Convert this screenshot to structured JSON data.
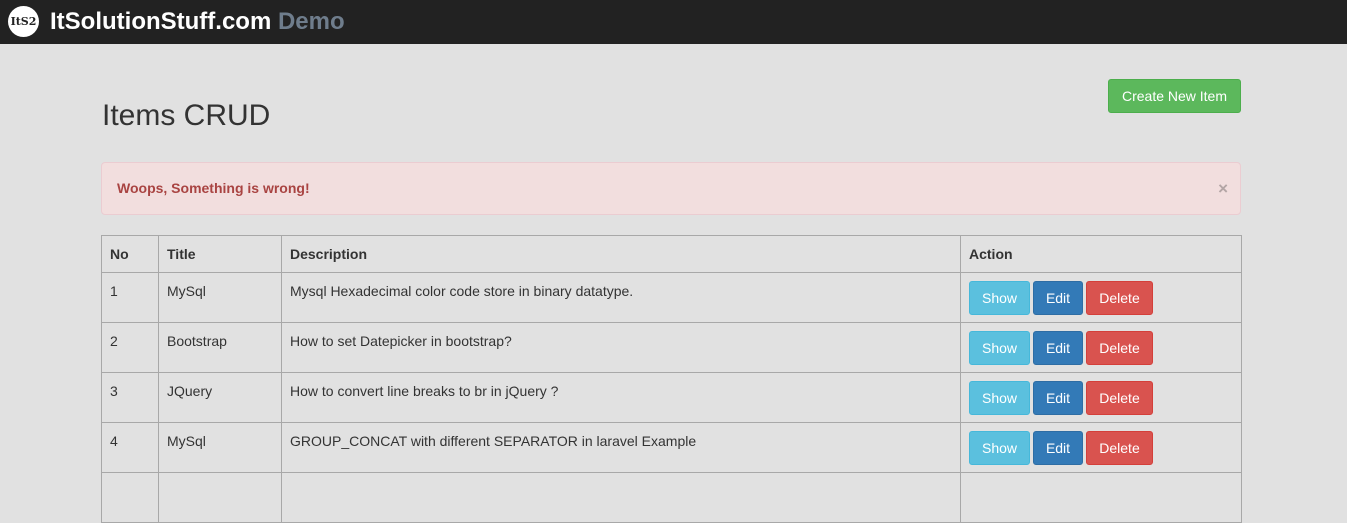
{
  "header": {
    "logo_text": "ItS2",
    "site_name": "ItSolutionStuff.com",
    "site_suffix": "Demo"
  },
  "main": {
    "title": "Items CRUD",
    "create_button": "Create New Item",
    "alert": {
      "message": "Woops, Something is wrong!",
      "close": "×"
    }
  },
  "table": {
    "headers": [
      "No",
      "Title",
      "Description",
      "Action"
    ],
    "rows": [
      {
        "no": "1",
        "title": "MySql",
        "description": "Mysql Hexadecimal color code store in binary datatype."
      },
      {
        "no": "2",
        "title": "Bootstrap",
        "description": "How to set Datepicker in bootstrap?"
      },
      {
        "no": "3",
        "title": "JQuery",
        "description": "How to convert line breaks to br in jQuery ?"
      },
      {
        "no": "4",
        "title": "MySql",
        "description": "GROUP_CONCAT with different SEPARATOR in laravel Example"
      }
    ],
    "actions": {
      "show": "Show",
      "edit": "Edit",
      "delete": "Delete"
    }
  },
  "colors": {
    "navbar": "#222222",
    "success": "#5cb85c",
    "info": "#5bc0de",
    "primary": "#337ab7",
    "danger": "#d9534f",
    "alert_bg": "#f2dede",
    "alert_text": "#a94442"
  }
}
